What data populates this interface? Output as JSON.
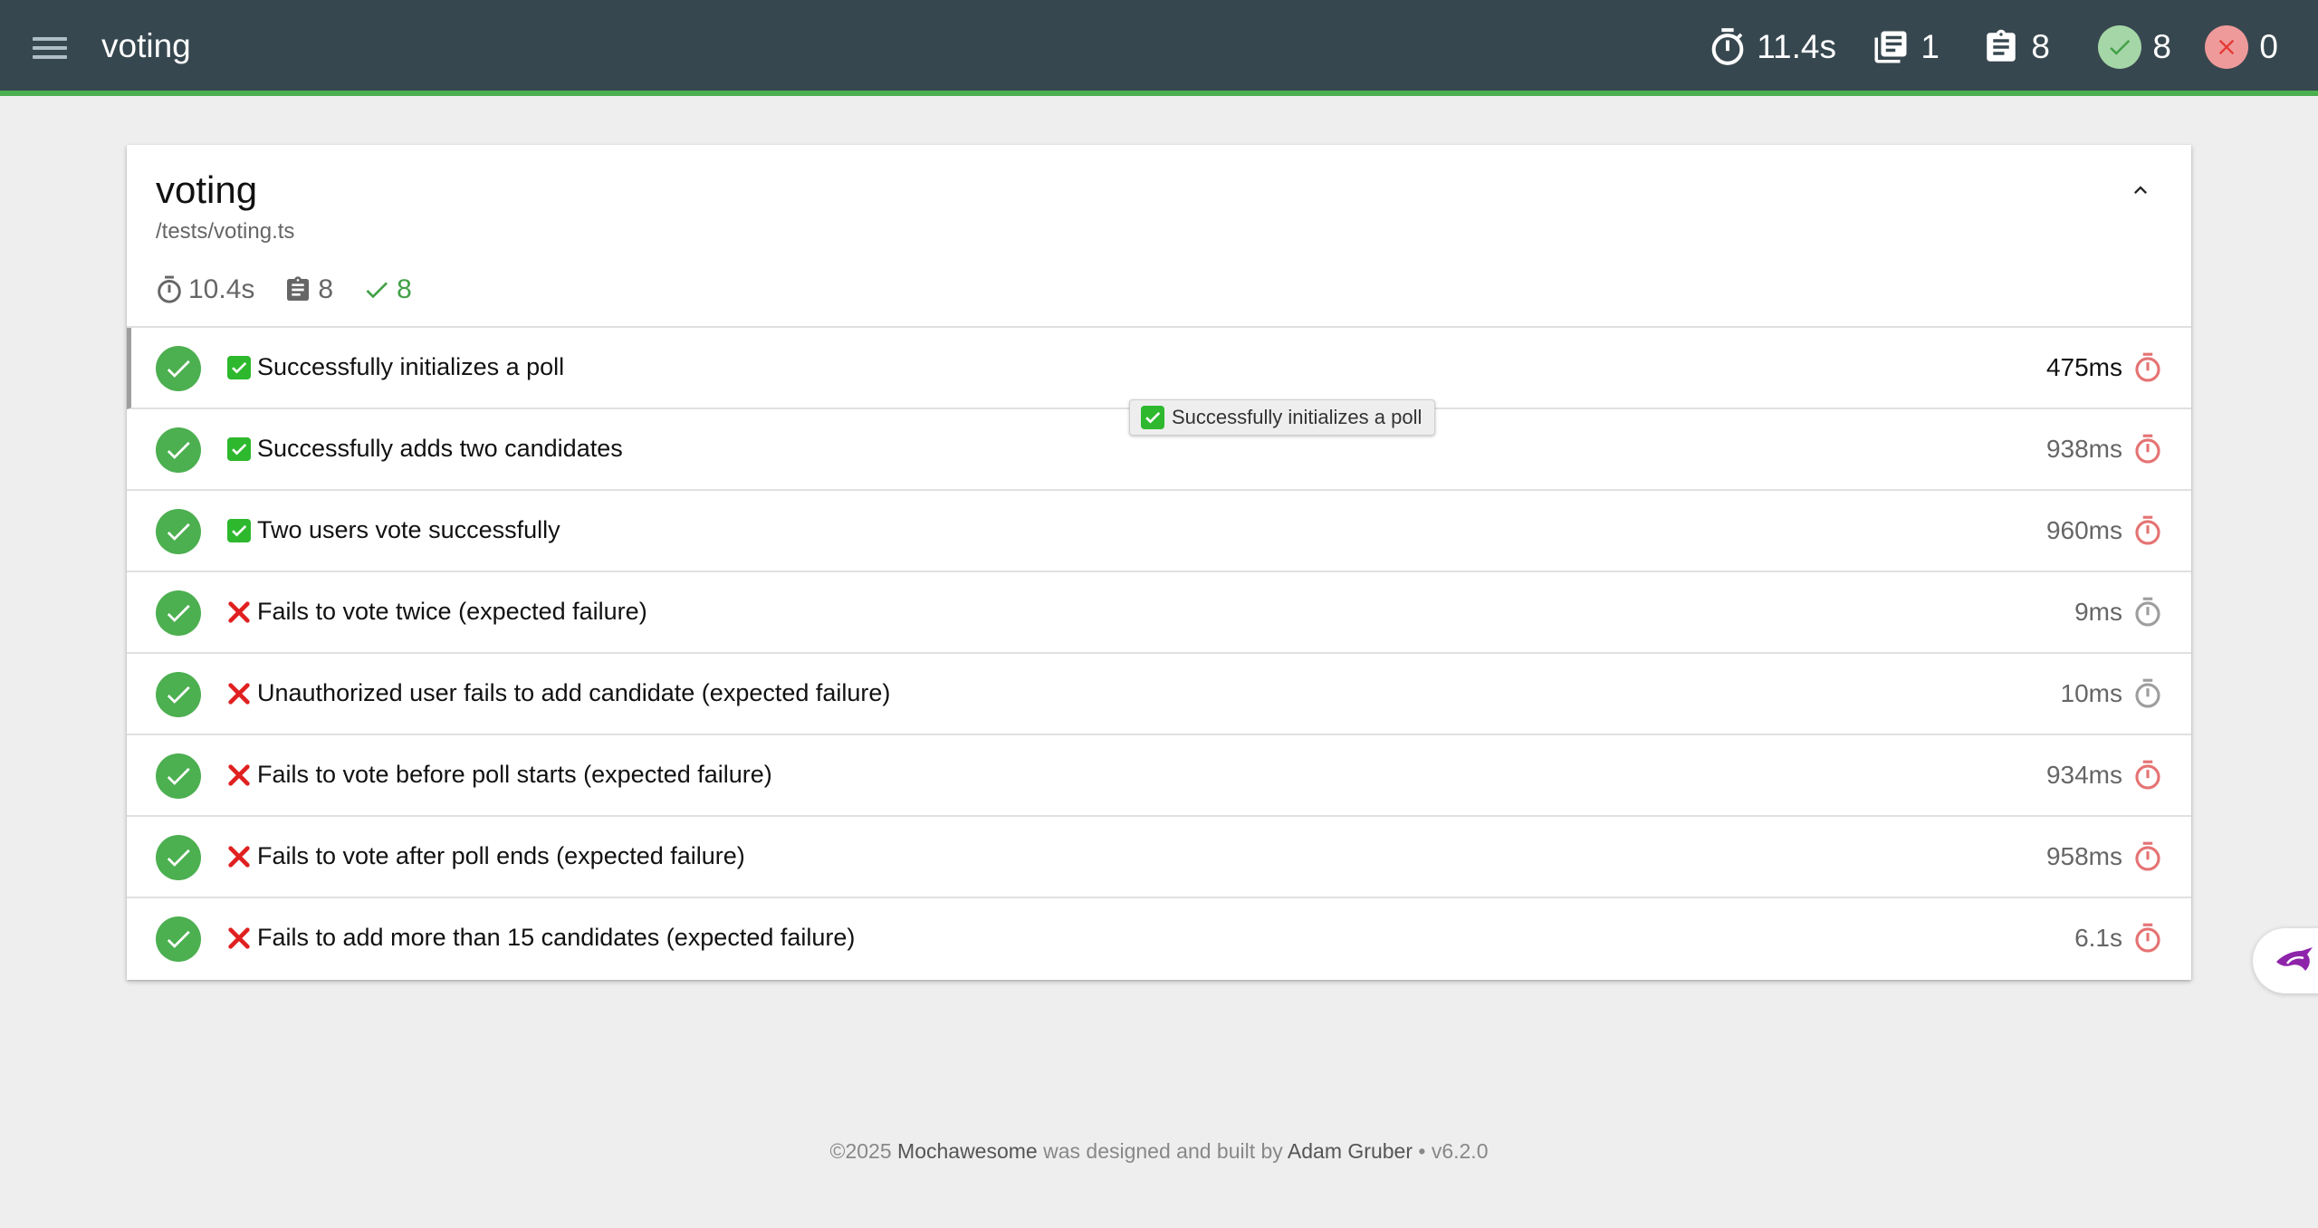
{
  "navbar": {
    "title": "voting",
    "stats": {
      "duration": "11.4s",
      "suites": "1",
      "tests": "8",
      "passes": "8",
      "failures": "0"
    }
  },
  "suite": {
    "title": "voting",
    "file": "/tests/voting.ts",
    "duration": "10.4s",
    "tests": "8",
    "passes": "8"
  },
  "tests": [
    {
      "emoji": "✅",
      "title": "Successfully initializes a poll",
      "duration": "475ms",
      "speed": "slow"
    },
    {
      "emoji": "✅",
      "title": "Successfully adds two candidates",
      "duration": "938ms",
      "speed": "slow"
    },
    {
      "emoji": "✅",
      "title": "Two users vote successfully",
      "duration": "960ms",
      "speed": "slow"
    },
    {
      "emoji": "❌",
      "title": "Fails to vote twice (expected failure)",
      "duration": "9ms",
      "speed": "fast"
    },
    {
      "emoji": "❌",
      "title": "Unauthorized user fails to add candidate (expected failure)",
      "duration": "10ms",
      "speed": "fast"
    },
    {
      "emoji": "❌",
      "title": "Fails to vote before poll starts (expected failure)",
      "duration": "934ms",
      "speed": "slow"
    },
    {
      "emoji": "❌",
      "title": "Fails to vote after poll ends (expected failure)",
      "duration": "958ms",
      "speed": "slow"
    },
    {
      "emoji": "❌",
      "title": "Fails to add more than 15 candidates (expected failure)",
      "duration": "6.1s",
      "speed": "slow"
    }
  ],
  "tooltip": {
    "text": "Successfully initializes a poll"
  },
  "footer": {
    "copyright": "©2025",
    "brand": "Mochawesome",
    "middle": "was designed and built by",
    "author": "Adam Gruber",
    "sep": "•",
    "version": "v6.2.0"
  },
  "colors": {
    "navbar": "#37474f",
    "pass": "#4caf50",
    "fail": "#f44336",
    "slow_timer": "#e57373",
    "fast_timer": "#9e9e9e",
    "widget_accent": "#8e24aa"
  }
}
